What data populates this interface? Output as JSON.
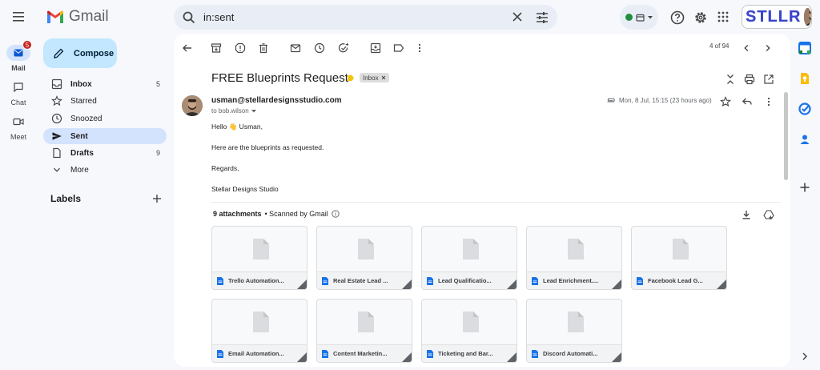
{
  "app": {
    "name": "Gmail"
  },
  "search": {
    "value": "in:sent"
  },
  "brand": {
    "text": "STLLR"
  },
  "rail": {
    "mail": {
      "label": "Mail",
      "badge": "5"
    },
    "chat": {
      "label": "Chat"
    },
    "meet": {
      "label": "Meet"
    }
  },
  "compose": {
    "label": "Compose"
  },
  "nav": [
    {
      "label": "Inbox",
      "count": "5"
    },
    {
      "label": "Starred",
      "count": ""
    },
    {
      "label": "Snoozed",
      "count": ""
    },
    {
      "label": "Sent",
      "count": ""
    },
    {
      "label": "Drafts",
      "count": "9"
    },
    {
      "label": "More",
      "count": ""
    }
  ],
  "labels": {
    "title": "Labels"
  },
  "toolbar": {
    "count": "4 of 94"
  },
  "email": {
    "subject": "FREE Blueprints Request",
    "chip": "Inbox",
    "sender": "usman@stellardesignsstudio.com",
    "to": "to bob.wilson",
    "date": "Mon, 8 Jul, 15:15 (23 hours ago)",
    "body": [
      "Hello 👋 Usman,",
      "Here are the blueprints as requested.",
      "Regards,",
      "Stellar Designs Studio"
    ]
  },
  "attachments": {
    "count_label": "9 attachments",
    "scan_label": "• Scanned by Gmail",
    "items": [
      "Trello Automation...",
      "Real Estate Lead ...",
      "Lead Qualificatio...",
      "Lead Enrichment....",
      "Facebook Lead G...",
      "Email Automation...",
      "Content Marketin...",
      "Ticketing and Bar...",
      "Discord Automati..."
    ]
  },
  "colors": {
    "accent": "#0b57d0",
    "compose_bg": "#c2e7ff",
    "nav_active": "#d3e3fd",
    "badge": "#c5221f",
    "doc_blue": "#1a73e8"
  }
}
